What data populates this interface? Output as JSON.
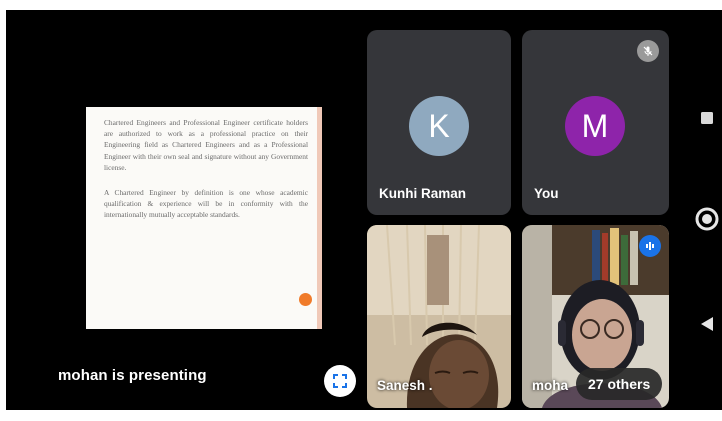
{
  "presentation": {
    "slide_paragraphs": [
      "Chartered Engineers and Professional Engineer certificate holders are authorized to work as a professional practice on their Engineering field as Chartered Engineers and as a Professional Engineer with their own seal and signature without any Government license.",
      "A Chartered Engineer by definition is one whose academic qualification & experience will be in conformity with the internationally mutually acceptable standards."
    ],
    "presenting_label": "mohan is presenting"
  },
  "participants": {
    "kunhi": {
      "initial": "K",
      "name": "Kunhi Raman",
      "avatar_color": "#8fa9bf"
    },
    "you": {
      "initial": "M",
      "name": "You",
      "avatar_color": "#8e24aa"
    },
    "sanesh": {
      "name": "Sanesh ."
    },
    "mohan": {
      "name": "moha"
    }
  },
  "others_chip": "27 others",
  "icons": {
    "fullscreen": "fullscreen-icon",
    "mic_off": "mic-off-icon",
    "speaking": "audio-level-icon",
    "nav_recents": "square-icon",
    "nav_home": "circle-icon",
    "nav_back": "triangle-back-icon"
  }
}
